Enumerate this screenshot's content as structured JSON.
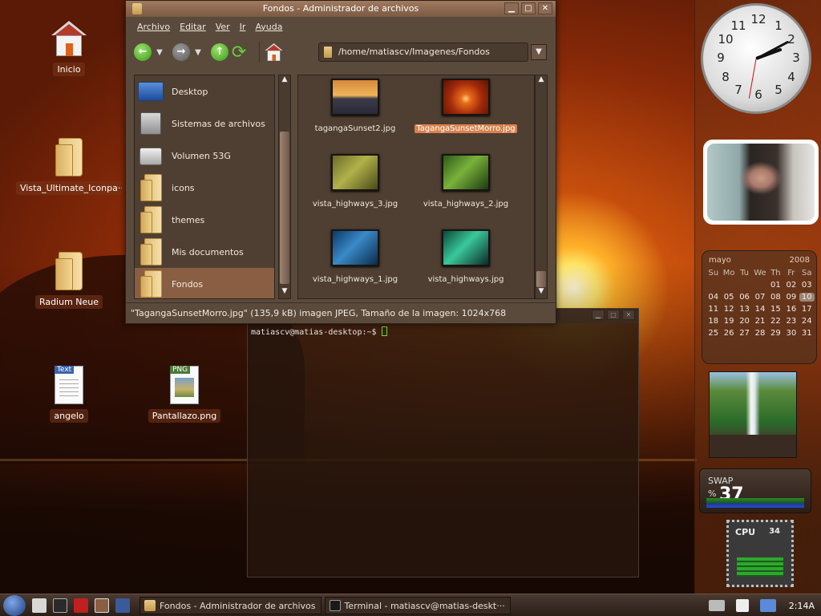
{
  "desktop": {
    "icons": [
      {
        "label": "Inicio",
        "icon": "home-icon"
      },
      {
        "label": "Vista_Ultimate_Iconpa···",
        "icon": "folder-icon"
      },
      {
        "label": "Radium Neue",
        "icon": "folder-icon"
      },
      {
        "label": "angelo",
        "icon": "text-file-icon",
        "tag": "Text"
      },
      {
        "label": "Pantallazo.png",
        "icon": "png-file-icon",
        "tag": "PNG"
      }
    ]
  },
  "file_manager": {
    "title": "Fondos - Administrador de archivos",
    "menu": [
      "Archivo",
      "Editar",
      "Ver",
      "Ir",
      "Ayuda"
    ],
    "location": "/home/matiascv/Imagenes/Fondos",
    "sidebar": [
      {
        "label": "Desktop",
        "icon": "desktop-icon"
      },
      {
        "label": "Sistemas de archivos",
        "icon": "harddisk-icon"
      },
      {
        "label": "Volumen 53G",
        "icon": "volume-icon"
      },
      {
        "label": "icons",
        "icon": "folder-icon"
      },
      {
        "label": "themes",
        "icon": "folder-icon"
      },
      {
        "label": "Mis documentos",
        "icon": "folder-icon"
      },
      {
        "label": "Fondos",
        "icon": "folder-icon",
        "selected": true
      }
    ],
    "files": [
      {
        "name": "tagangaSunset2.jpg",
        "selected": false
      },
      {
        "name": "TagangaSunsetMorro.jpg",
        "selected": true
      },
      {
        "name": "vista_highways_3.jpg",
        "selected": false
      },
      {
        "name": "vista_highways_2.jpg",
        "selected": false
      },
      {
        "name": "vista_highways_1.jpg",
        "selected": false
      },
      {
        "name": "vista_highways.jpg",
        "selected": false
      }
    ],
    "status": "\"TagangaSunsetMorro.jpg\" (135,9 kB) imagen JPEG, Tamaño de la imagen: 1024x768"
  },
  "terminal": {
    "prompt": "matiascv@matias-desktop:~$"
  },
  "gadgets": {
    "clock_numbers": [
      "12",
      "1",
      "2",
      "3",
      "4",
      "5",
      "6",
      "7",
      "8",
      "9",
      "10",
      "11"
    ],
    "calendar": {
      "month": "mayo",
      "year": "2008",
      "day_names": [
        "Su",
        "Mo",
        "Tu",
        "We",
        "Th",
        "Fr",
        "Sa"
      ],
      "days": [
        "",
        "",
        "",
        "",
        "01",
        "02",
        "03",
        "04",
        "05",
        "06",
        "07",
        "08",
        "09",
        "10",
        "11",
        "12",
        "13",
        "14",
        "15",
        "16",
        "17",
        "18",
        "19",
        "20",
        "21",
        "22",
        "23",
        "24",
        "25",
        "26",
        "27",
        "28",
        "29",
        "30",
        "31"
      ],
      "today": "10"
    },
    "swap": {
      "label": "SWAP",
      "unit": "%",
      "value": "37"
    },
    "cpu": {
      "label": "CPU",
      "value": "34"
    }
  },
  "taskbar": {
    "tasks": [
      {
        "label": "Fondos - Administrador de archivos",
        "icon": "folder-icon"
      },
      {
        "label": "Terminal - matiascv@matias-deskt···",
        "icon": "terminal-icon"
      }
    ],
    "clock": "2:14A"
  }
}
